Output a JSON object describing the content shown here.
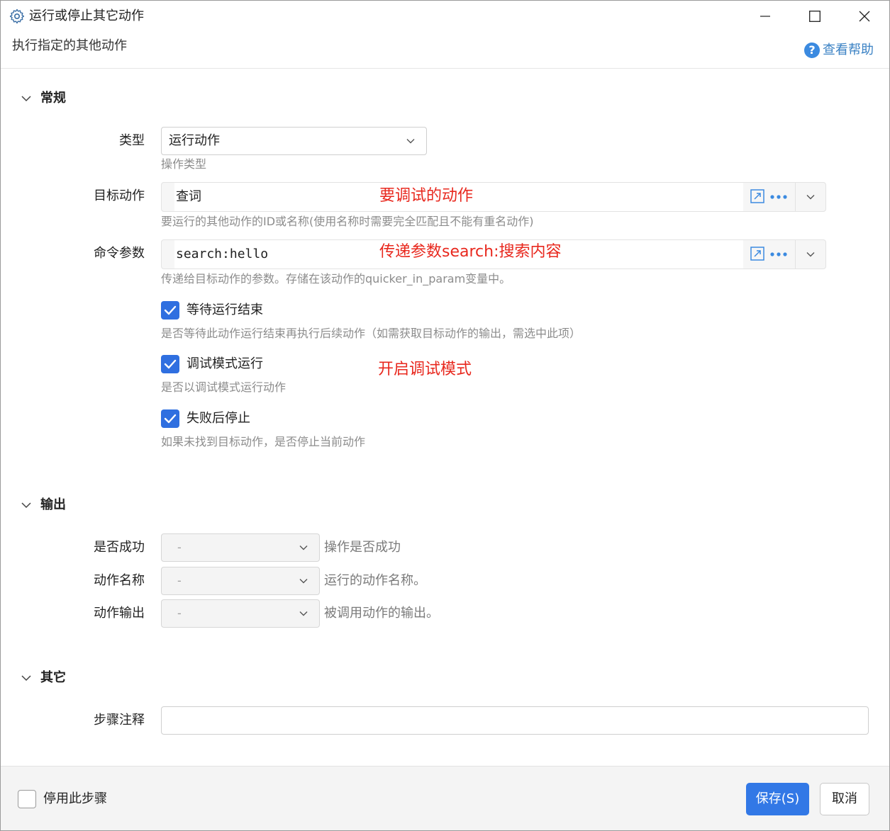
{
  "window": {
    "title": "运行或停止其它动作",
    "subtitle": "执行指定的其他动作",
    "help_label": "查看帮助",
    "help_icon": "question-circle-icon"
  },
  "sections": {
    "general": "常规",
    "output": "输出",
    "other": "其它"
  },
  "general": {
    "type_label": "类型",
    "type_value": "运行动作",
    "type_hint": "操作类型",
    "target_label": "目标动作",
    "target_value": "查词",
    "target_hint": "要运行的其他动作的ID或名称(使用名称时需要完全匹配且不能有重名动作)",
    "param_label": "命令参数",
    "param_value": "search:hello",
    "param_hint": "传递给目标动作的参数。存储在该动作的quicker_in_param变量中。",
    "wait_label": "等待运行结束",
    "wait_checked": true,
    "wait_hint": "是否等待此动作运行结束再执行后续动作（如需获取目标动作的输出，需选中此项）",
    "debug_label": "调试模式运行",
    "debug_checked": true,
    "debug_hint": "是否以调试模式运行动作",
    "stop_label": "失败后停止",
    "stop_checked": true,
    "stop_hint": "如果未找到目标动作，是否停止当前动作"
  },
  "annotations": {
    "target": "要调试的动作",
    "param": "传递参数search:搜索内容",
    "debug": "开启调试模式"
  },
  "output": {
    "rows": [
      {
        "label": "是否成功",
        "value": "-",
        "desc": "操作是否成功"
      },
      {
        "label": "动作名称",
        "value": "-",
        "desc": "运行的动作名称。"
      },
      {
        "label": "动作输出",
        "value": "-",
        "desc": "被调用动作的输出。"
      }
    ]
  },
  "other": {
    "note_label": "步骤注释",
    "note_value": ""
  },
  "footer": {
    "disable_label": "停用此步骤",
    "disable_checked": false,
    "save_label": "保存(S)",
    "cancel_label": "取消"
  },
  "colors": {
    "accent": "#3278e6",
    "annotation": "#e8281e",
    "link": "#3b82c4"
  }
}
